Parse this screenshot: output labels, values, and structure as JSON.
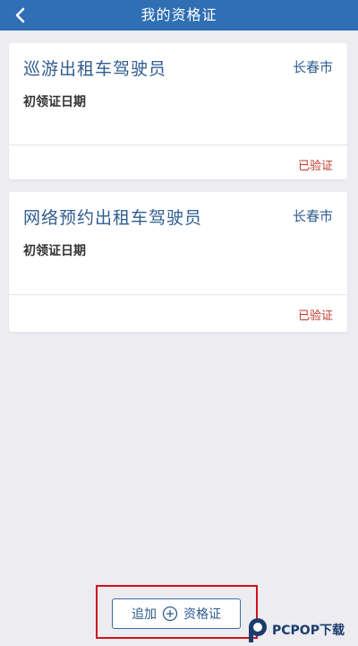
{
  "header": {
    "title": "我的资格证",
    "back_icon": "chevron-left-icon",
    "background_color": "#2f6fb4"
  },
  "certificates": [
    {
      "title": "巡游出租车驾驶员",
      "city": "长春市",
      "issue_label": "初领证日期",
      "status": "已验证"
    },
    {
      "title": "网络预约出租车驾驶员",
      "city": "长春市",
      "issue_label": "初领证日期",
      "status": "已验证"
    }
  ],
  "add_button": {
    "label_left": "追加",
    "icon": "plus-circle-icon",
    "label_right": "资格证",
    "highlight_color": "#d0121b"
  },
  "watermark": {
    "text": "PCPOP下载"
  },
  "colors": {
    "accent": "#2f5c8f",
    "status": "#c0392b"
  }
}
